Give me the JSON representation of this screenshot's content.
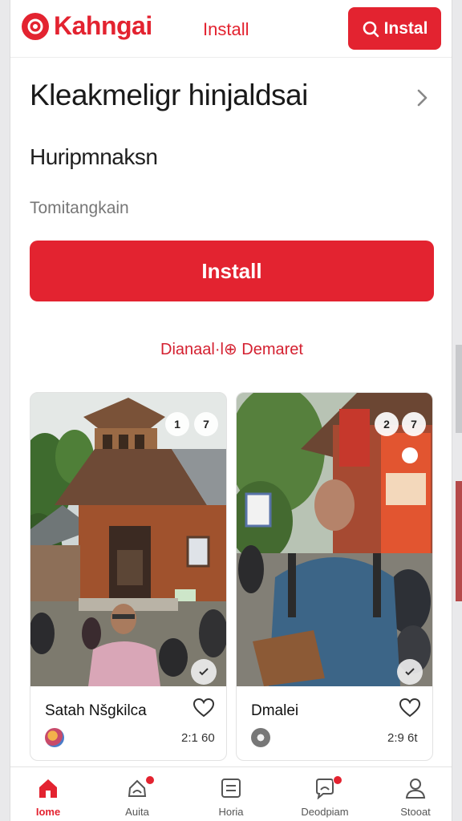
{
  "header": {
    "brand": "Kahngai",
    "install_link": "Install",
    "install_button": "Instal",
    "install_button_icon": "search-icon",
    "accent": "#e32330"
  },
  "main": {
    "title": "Kleakmeligr hinjaldsai",
    "subtitle": "Huripmnaksn",
    "hint": "Tomitangkain",
    "install_button": "Install",
    "section_link": "Dianaal·l⊕ Demaret"
  },
  "cards": [
    {
      "name": "Satah Nšgkilca",
      "badges": [
        "1",
        "7"
      ],
      "time": "2:1 60"
    },
    {
      "name": "Dmalei",
      "badges": [
        "2",
        "7"
      ],
      "time": "2:9 6t"
    }
  ],
  "nav": [
    {
      "label": "Iome",
      "icon": "home-icon",
      "active": true,
      "dot": false
    },
    {
      "label": "Auita",
      "icon": "bell-icon",
      "active": false,
      "dot": true
    },
    {
      "label": "Horia",
      "icon": "list-icon",
      "active": false,
      "dot": false
    },
    {
      "label": "Deodpiam",
      "icon": "chat-icon",
      "active": false,
      "dot": true
    },
    {
      "label": "Stooat",
      "icon": "user-icon",
      "active": false,
      "dot": false
    }
  ]
}
